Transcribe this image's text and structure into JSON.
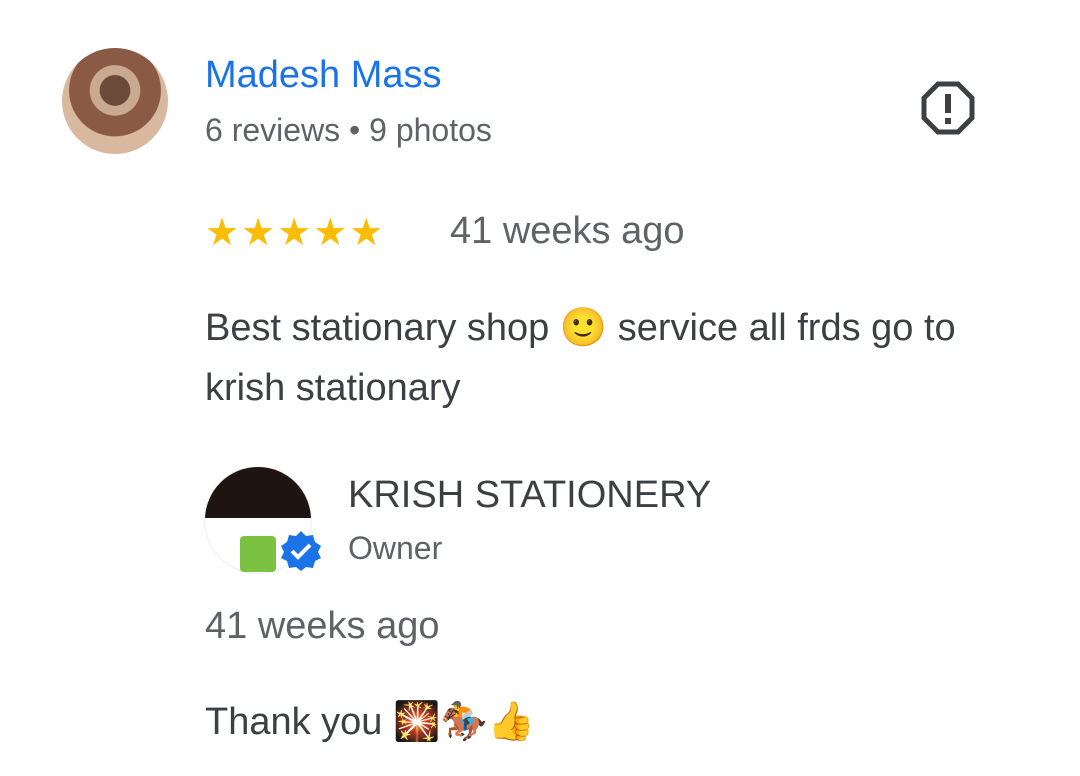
{
  "reviewer": {
    "name": "Madesh Mass",
    "meta": "6 reviews • 9 photos"
  },
  "review": {
    "stars": "★★★★★",
    "rating": 5,
    "date": "41 weeks ago",
    "text": "Best stationary shop 🙂 service all frds go to krish stationary"
  },
  "owner_reply": {
    "name": "KRISH STATIONERY",
    "role": "Owner",
    "date": "41 weeks ago",
    "text": "Thank you 🎇🏇👍"
  },
  "colors": {
    "link": "#1a73e8",
    "star": "#fbbc04",
    "verified": "#1a73e8"
  }
}
